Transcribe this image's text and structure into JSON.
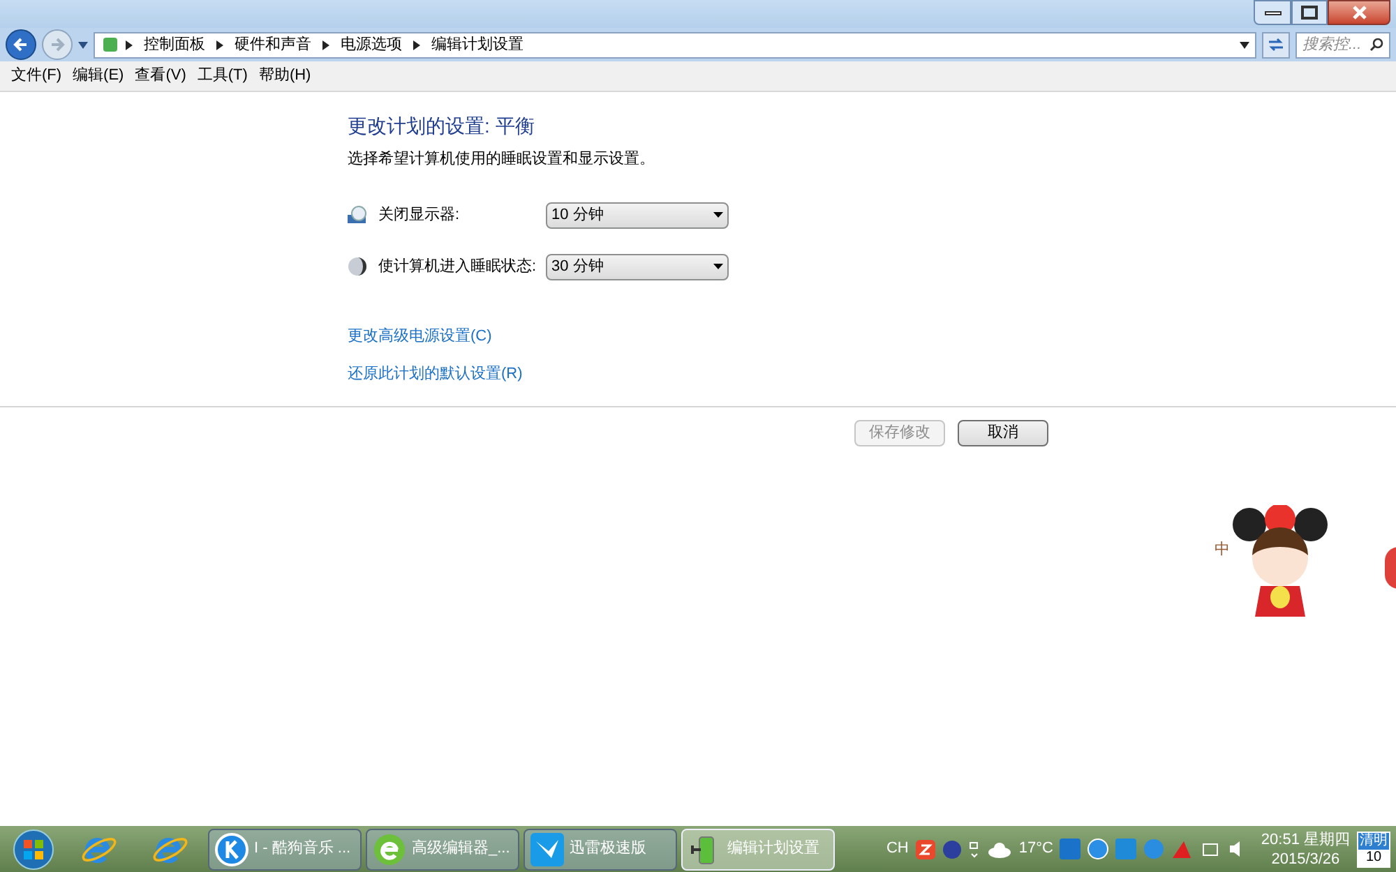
{
  "breadcrumb": [
    "控制面板",
    "硬件和声音",
    "电源选项",
    "编辑计划设置"
  ],
  "search": {
    "placeholder": "搜索控..."
  },
  "menu": [
    "文件(F)",
    "编辑(E)",
    "查看(V)",
    "工具(T)",
    "帮助(H)"
  ],
  "heading": "更改计划的设置: 平衡",
  "description": "选择希望计算机使用的睡眠设置和显示设置。",
  "settings": [
    {
      "kind": "display",
      "label": "关闭显示器:",
      "value": "10 分钟"
    },
    {
      "kind": "sleep",
      "label": "使计算机进入睡眠状态:",
      "value": "30 分钟"
    }
  ],
  "links": [
    "更改高级电源设置(C)",
    "还原此计划的默认设置(R)"
  ],
  "buttons": [
    {
      "label": "保存修改",
      "disabled": true
    },
    {
      "label": "取消",
      "disabled": false
    }
  ],
  "ime_mode": "中",
  "taskbar": {
    "pinned": [
      {
        "kind": "start"
      },
      {
        "kind": "ie"
      },
      {
        "kind": "ie"
      }
    ],
    "tasks": [
      {
        "kind": "k",
        "label": "I - 酷狗音乐 ...",
        "selected": false
      },
      {
        "kind": "e",
        "label": "高级编辑器_...",
        "selected": false
      },
      {
        "kind": "bird",
        "label": "迅雷极速版",
        "selected": false
      },
      {
        "kind": "power",
        "label": "编辑计划设置",
        "selected": true
      }
    ],
    "language": "CH",
    "temperature": "17°C",
    "time": "20:51 星期四",
    "date": "2015/3/26",
    "calendar_label": "清明",
    "calendar_day": "10"
  }
}
